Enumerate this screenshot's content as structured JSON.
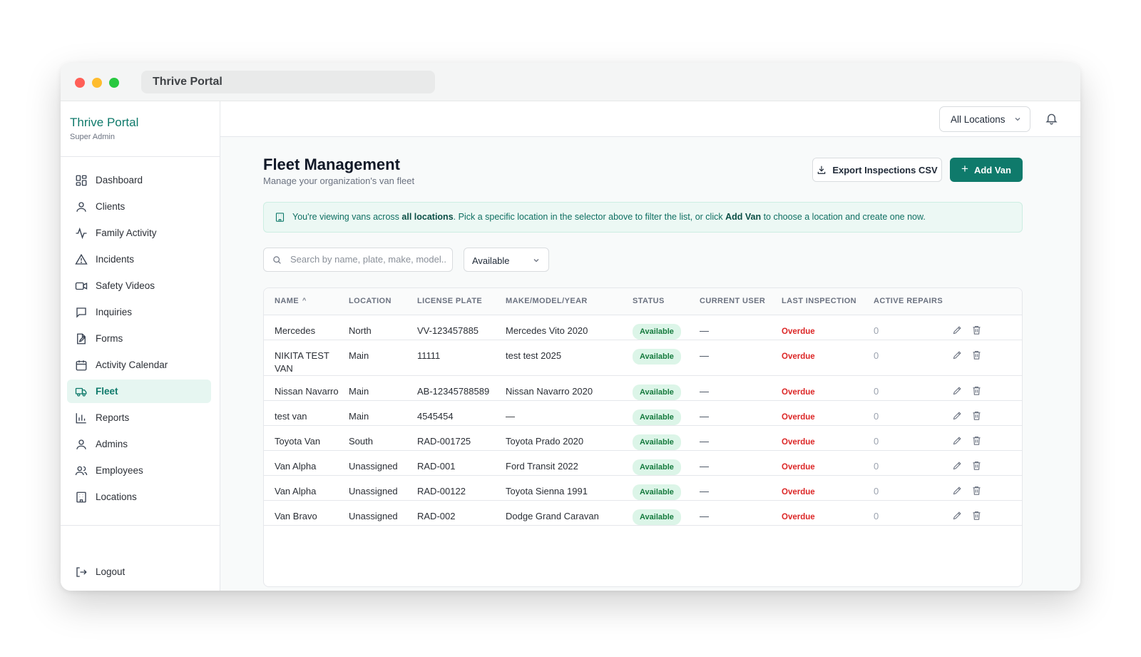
{
  "window": {
    "title": "Thrive Portal"
  },
  "sidebar": {
    "brand": "Thrive Portal",
    "role": "Super Admin",
    "items": [
      {
        "label": "Dashboard",
        "icon": "dashboard-icon"
      },
      {
        "label": "Clients",
        "icon": "user-icon"
      },
      {
        "label": "Family Activity",
        "icon": "activity-icon"
      },
      {
        "label": "Incidents",
        "icon": "warning-icon"
      },
      {
        "label": "Safety Videos",
        "icon": "video-icon"
      },
      {
        "label": "Inquiries",
        "icon": "message-icon"
      },
      {
        "label": "Forms",
        "icon": "form-icon"
      },
      {
        "label": "Activity Calendar",
        "icon": "calendar-icon"
      },
      {
        "label": "Fleet",
        "icon": "truck-icon",
        "active": true
      },
      {
        "label": "Reports",
        "icon": "chart-icon"
      },
      {
        "label": "Admins",
        "icon": "user-icon"
      },
      {
        "label": "Employees",
        "icon": "users-icon"
      },
      {
        "label": "Locations",
        "icon": "building-icon"
      }
    ],
    "logout": "Logout"
  },
  "topbar": {
    "location_select": "All Locations"
  },
  "page": {
    "title": "Fleet Management",
    "subtitle": "Manage your organization's van fleet",
    "export_label": "Export Inspections CSV",
    "add_label": "Add Van"
  },
  "banner": {
    "part1": "You're viewing vans across ",
    "bold1": "all locations",
    "part2": ". Pick a specific location in the selector above to filter the list, or click ",
    "bold2": "Add Van",
    "part3": " to choose a location and create one now."
  },
  "filters": {
    "search_placeholder": "Search by name, plate, make, model...",
    "status_value": "Available"
  },
  "table": {
    "columns": [
      "NAME",
      "LOCATION",
      "LICENSE PLATE",
      "MAKE/MODEL/YEAR",
      "STATUS",
      "CURRENT USER",
      "LAST INSPECTION",
      "ACTIVE REPAIRS"
    ],
    "rows": [
      {
        "name": "Mercedes",
        "location": "North",
        "plate": "VV-123457885",
        "make": "Mercedes Vito 2020",
        "status": "Available",
        "user": "—",
        "inspection": "Overdue",
        "repairs": "0"
      },
      {
        "name": "NIKITA TEST VAN",
        "location": "Main",
        "plate": "11111",
        "make": "test test 2025",
        "status": "Available",
        "user": "—",
        "inspection": "Overdue",
        "repairs": "0"
      },
      {
        "name": "Nissan Navarro",
        "location": "Main",
        "plate": "AB-12345788589",
        "make": "Nissan Navarro 2020",
        "status": "Available",
        "user": "—",
        "inspection": "Overdue",
        "repairs": "0"
      },
      {
        "name": "test van",
        "location": "Main",
        "plate": "4545454",
        "make": "—",
        "status": "Available",
        "user": "—",
        "inspection": "Overdue",
        "repairs": "0"
      },
      {
        "name": "Toyota Van",
        "location": "South",
        "plate": "RAD-001725",
        "make": "Toyota Prado 2020",
        "status": "Available",
        "user": "—",
        "inspection": "Overdue",
        "repairs": "0"
      },
      {
        "name": "Van Alpha",
        "location": "Unassigned",
        "plate": "RAD-001",
        "make": "Ford Transit 2022",
        "status": "Available",
        "user": "—",
        "inspection": "Overdue",
        "repairs": "0"
      },
      {
        "name": "Van Alpha",
        "location": "Unassigned",
        "plate": "RAD-00122",
        "make": "Toyota Sienna 1991",
        "status": "Available",
        "user": "—",
        "inspection": "Overdue",
        "repairs": "0"
      },
      {
        "name": "Van Bravo",
        "location": "Unassigned",
        "plate": "RAD-002",
        "make": "Dodge Grand Caravan",
        "status": "Available",
        "user": "—",
        "inspection": "Overdue",
        "repairs": "0"
      }
    ]
  },
  "colors": {
    "accent": "#0f7a6b",
    "overdue": "#dc2626",
    "available_bg": "#dcf5e8"
  }
}
